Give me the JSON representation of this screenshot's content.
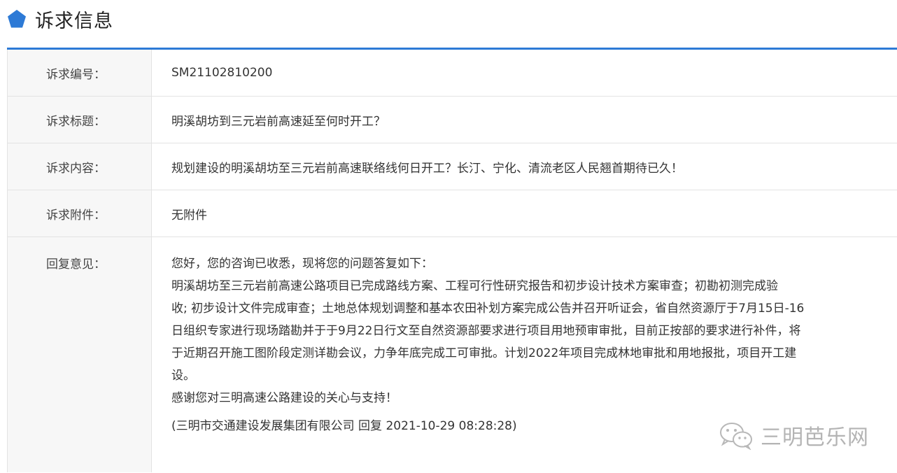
{
  "header": {
    "title": "诉求信息",
    "icon": "pentagon-icon",
    "icon_color": "#2d7ad6"
  },
  "rows": [
    {
      "label": "诉求编号：",
      "value": "SM21102810200"
    },
    {
      "label": "诉求标题：",
      "value": "明溪胡坊到三元岩前高速延至何时开工？"
    },
    {
      "label": "诉求内容：",
      "value": "规划建设的明溪胡坊至三元岩前高速联络线何日开工？长汀、宁化、清流老区人民翘首期待已久！"
    },
    {
      "label": "诉求附件：",
      "value": "无附件"
    }
  ],
  "reply": {
    "label": "回复意见：",
    "lines": [
      "您好，您的咨询已收悉，现将您的问题答复如下：",
      "明溪胡坊至三元岩前高速公路项目已完成路线方案、工程可行性研究报告和初步设计技术方案审查；初勘初测完成验",
      "收; 初步设计文件完成审查；土地总体规划调整和基本农田补划方案完成公告并召开听证会，省自然资源厅于7月15日-16",
      "日组织专家进行现场踏勘并于于9月22日行文至自然资源部要求进行项目用地预审审批，目前正按部的要求进行补件，将",
      "于近期召开施工图阶段定测详勘会议，力争年底完成工可审批。计划2022年项目完成林地审批和用地报批，项目开工建",
      "设。",
      "感谢您对三明高速公路建设的关心与支持！"
    ],
    "signature": "(三明市交通建设发展集团有限公司 回复 2021-10-29 08:28:28)"
  },
  "watermark": {
    "icon": "wechat-icon",
    "text": "三明芭乐网"
  },
  "colors": {
    "accent": "#2d7ad6",
    "label_bg": "#f7f7f7",
    "border": "#e3e3e3"
  }
}
